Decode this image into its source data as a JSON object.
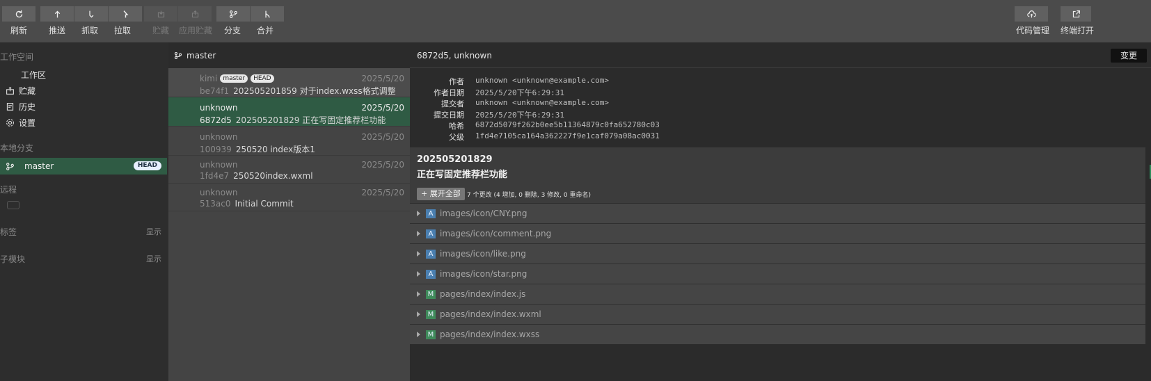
{
  "toolbar": {
    "buttons": [
      {
        "label": "刷新",
        "icon": "refresh-icon",
        "enabled": true
      },
      {
        "label": "推送",
        "icon": "push-icon",
        "enabled": true
      },
      {
        "label": "抓取",
        "icon": "fetch-icon",
        "enabled": true
      },
      {
        "label": "拉取",
        "icon": "pull-icon",
        "enabled": true
      },
      {
        "label": "贮藏",
        "icon": "stash-icon",
        "enabled": false
      },
      {
        "label": "应用贮藏",
        "icon": "apply-stash-icon",
        "enabled": false
      },
      {
        "label": "分支",
        "icon": "branch-icon",
        "enabled": true
      },
      {
        "label": "合并",
        "icon": "merge-icon",
        "enabled": true
      }
    ],
    "right": [
      {
        "label": "代码管理",
        "icon": "cloud-upload-icon"
      },
      {
        "label": "终端打开",
        "icon": "external-link-icon"
      }
    ]
  },
  "sidebar": {
    "workspace_title": "工作空间",
    "workspace_items": [
      {
        "label": "工作区",
        "icon": ""
      },
      {
        "label": "贮藏",
        "icon": "stash-icon"
      },
      {
        "label": "历史",
        "icon": "history-icon"
      },
      {
        "label": "设置",
        "icon": "gear-icon"
      }
    ],
    "local_branches_title": "本地分支",
    "branch": {
      "name": "master",
      "badge": "HEAD"
    },
    "remote_title": "远程",
    "tags_title": "标签",
    "tags_show": "显示",
    "submodules_title": "子模块",
    "submodules_show": "显示"
  },
  "commits_panel": {
    "branch_label": "master",
    "commits": [
      {
        "author": "kimi",
        "tags": [
          "master",
          "HEAD"
        ],
        "date": "2025/5/20",
        "hash": "be74f1",
        "message": "202505201859 对于index.wxss格式调整"
      },
      {
        "author": "unknown",
        "tags": [],
        "date": "2025/5/20",
        "hash": "6872d5",
        "message": "202505201829 正在写固定推荐栏功能"
      },
      {
        "author": "unknown",
        "tags": [],
        "date": "2025/5/20",
        "hash": "100939",
        "message": "250520 index版本1"
      },
      {
        "author": "unknown",
        "tags": [],
        "date": "2025/5/20",
        "hash": "1fd4e7",
        "message": "250520index.wxml"
      },
      {
        "author": "unknown",
        "tags": [],
        "date": "2025/5/20",
        "hash": "513ac0",
        "message": "Initial Commit"
      }
    ]
  },
  "detail": {
    "header": "6872d5, unknown",
    "change_button": "变更",
    "meta": [
      {
        "key": "作者",
        "value": "unknown <unknown@example.com>"
      },
      {
        "key": "作者日期",
        "value": "2025/5/20下午6:29:31"
      },
      {
        "key": "提交者",
        "value": "unknown <unknown@example.com>"
      },
      {
        "key": "提交日期",
        "value": "2025/5/20下午6:29:31"
      },
      {
        "key": "哈希",
        "value": "6872d5079f262b0ee5b11364879c0fa652780c03"
      },
      {
        "key": "父级",
        "value": "1fd4e7105ca164a362227f9e1caf079a08ac0031"
      }
    ],
    "message_title": "202505201829",
    "message_body": "正在写固定推荐栏功能",
    "expand_all": "+ 展开全部",
    "summary": "7 个更改 (4 增加, 0 删除, 3 修改, 0 重命名)",
    "files": [
      {
        "status": "A",
        "path": "images/icon/CNY.png"
      },
      {
        "status": "A",
        "path": "images/icon/comment.png"
      },
      {
        "status": "A",
        "path": "images/icon/like.png"
      },
      {
        "status": "A",
        "path": "images/icon/star.png"
      },
      {
        "status": "M",
        "path": "pages/index/index.js"
      },
      {
        "status": "M",
        "path": "pages/index/index.wxml"
      },
      {
        "status": "M",
        "path": "pages/index/index.wxss"
      }
    ]
  }
}
